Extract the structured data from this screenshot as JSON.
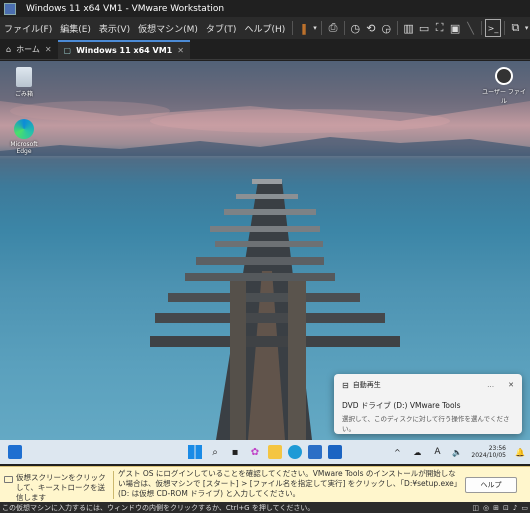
{
  "titlebar": {
    "title": "Windows 11 x64 VM1 - VMware Workstation"
  },
  "menubar": {
    "items": [
      "ファイル(F)",
      "編集(E)",
      "表示(V)",
      "仮想マシン(M)",
      "タブ(T)",
      "ヘルプ(H)"
    ]
  },
  "tabs": [
    {
      "label": "ホーム"
    },
    {
      "label": "Windows 11 x64 VM1"
    }
  ],
  "desktop": {
    "recycle_bin_label": "ごみ箱",
    "edge_label": "Microsoft Edge",
    "user_folder_label": "ユーザー ファイル"
  },
  "notification": {
    "header": "自動再生",
    "title": "DVD ドライブ (D:) VMware Tools",
    "body": "選択して、このディスクに対して行う操作を選んでください。"
  },
  "taskbar": {
    "time": "23:56",
    "date": "2024/10/05",
    "ime": "A"
  },
  "hint": {
    "left_text": "仮想スクリーンをクリックして、キーストロークを送信します",
    "main_text": "ゲスト OS にログインしていることを確認してください。VMware Tools のインストールが開始しない場合は、仮想マシンで [スタート] > [ファイル名を指定して実行] をクリックし、「D:¥setup.exe」(D: は仮想 CD-ROM ドライブ) と入力してください。",
    "help_button": "ヘルプ"
  },
  "status": {
    "text": "この仮想マシンに入力するには、ウィンドウの内側をクリックするか、Ctrl+G を押してください。"
  }
}
